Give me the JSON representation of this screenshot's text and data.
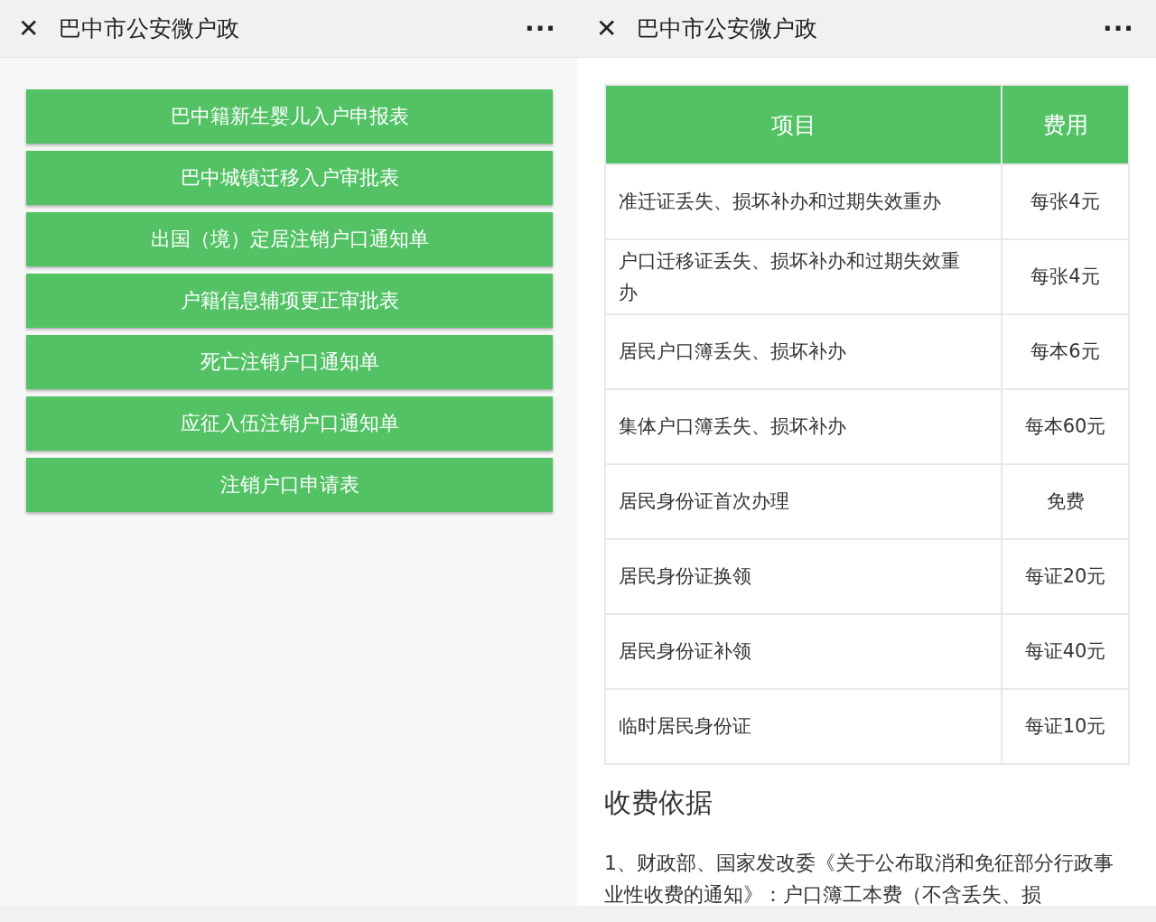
{
  "panes": [
    {
      "title": "巴中市公安微户政",
      "close": "✕",
      "more": "···",
      "kind": "buttons",
      "buttons": [
        "巴中籍新生婴儿入户申报表",
        "巴中城镇迁移入户审批表",
        "出国（境）定居注销户口通知单",
        "户籍信息辅项更正审批表",
        "死亡注销户口通知单",
        "应征入伍注销户口通知单",
        "注销户口申请表"
      ]
    },
    {
      "title": "巴中市公安微户政",
      "close": "✕",
      "more": "···",
      "kind": "fees",
      "table": {
        "columns": [
          "项目",
          "费用"
        ],
        "rows": [
          [
            "准迁证丢失、损坏补办和过期失效重办",
            "每张4元"
          ],
          [
            "户口迁移证丢失、损坏补办和过期失效重办",
            "每张4元"
          ],
          [
            "居民户口簿丢失、损坏补办",
            "每本6元"
          ],
          [
            "集体户口簿丢失、损坏补办",
            "每本60元"
          ],
          [
            "居民身份证首次办理",
            "免费"
          ],
          [
            "居民身份证换领",
            "每证20元"
          ],
          [
            "居民身份证补领",
            "每证40元"
          ],
          [
            "临时居民身份证",
            "每证10元"
          ]
        ]
      },
      "heading": "收费依据",
      "paragraph": "1、财政部、国家发改委《关于公布取消和免征部分行政事业性收费的通知》：户口簿工本费（不含丢失、损"
    }
  ]
}
